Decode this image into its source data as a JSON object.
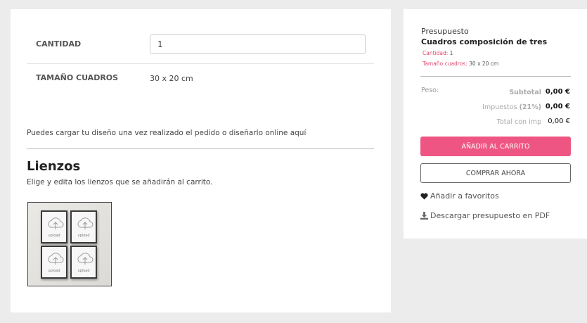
{
  "options": {
    "quantity_label": "CANTIDAD",
    "quantity_value": "1",
    "size_label": "TAMAÑO CUADROS",
    "size_value": "30 x 20 cm"
  },
  "upload_note": "Puedes cargar tu diseño una vez realizado el pedido o diseñarlo online aquí",
  "canvases": {
    "title": "Lienzos",
    "description": "Elige y edita los lienzos que se añadirán al carrito.",
    "frame_word": "upload"
  },
  "budget": {
    "title": "Presupuesto",
    "product_name": "Cuadros composición de tres",
    "meta": [
      {
        "key": "Cantidad:",
        "value": "1"
      },
      {
        "key": "Tamaño cuadros:",
        "value": "30 x 20 cm"
      }
    ],
    "peso_label": "Peso:",
    "subtotal_label": "Subtotal",
    "subtotal_value": "0,00 €",
    "tax_label": "Impuestos",
    "tax_rate": "(21%)",
    "tax_value": "0,00 €",
    "total_label": "Total con imp",
    "total_value": "0,00 €",
    "add_to_cart_label": "AÑADIR AL CARRITO",
    "buy_now_label": "COMPRAR AHORA",
    "favorites_label": "Añadir a favoritos",
    "pdf_label": "Descargar presupuesto en PDF"
  },
  "colors": {
    "accent": "#ef5582",
    "meta_key": "#e0466e",
    "background": "#ececec"
  },
  "icons": {
    "favorites": "heart-icon",
    "pdf": "download-icon",
    "canvas": "cloud-upload-icon"
  }
}
